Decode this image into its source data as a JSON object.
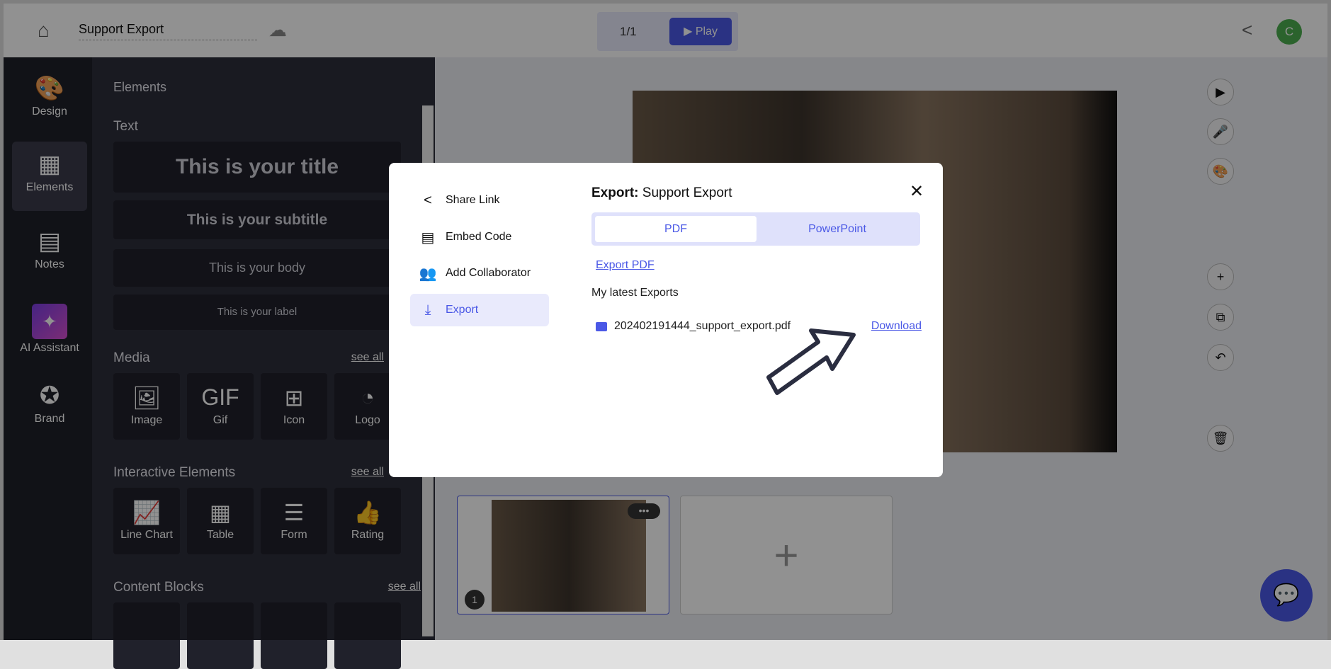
{
  "topbar": {
    "title": "Support Export",
    "page_indicator": "1/1",
    "play_label": "Play",
    "avatar_initial": "C",
    "avatar_color": "#4caf50"
  },
  "rail": [
    {
      "label": "Design",
      "icon": "palette-icon"
    },
    {
      "label": "Elements",
      "icon": "grid-icon"
    },
    {
      "label": "Notes",
      "icon": "notes-icon"
    },
    {
      "label": "AI Assistant",
      "icon": "sparkle-icon"
    },
    {
      "label": "Brand",
      "icon": "badge-check-icon"
    }
  ],
  "panel": {
    "heading": "Elements",
    "text_section": "Text",
    "text_cards": [
      "This is your title",
      "This is your subtitle",
      "This is your body",
      "This is your label"
    ],
    "media_section": "Media",
    "media_see_all": "see all",
    "media": [
      "Image",
      "Gif",
      "Icon",
      "Logo"
    ],
    "interactive_section": "Interactive Elements",
    "interactive_see_all": "see all",
    "interactive": [
      "Line Chart",
      "Table",
      "Form",
      "Rating"
    ],
    "content_section": "Content Blocks",
    "content_see_all": "see all"
  },
  "thumbnails": [
    {
      "number": "1"
    }
  ],
  "modal": {
    "nav": [
      "Share Link",
      "Embed Code",
      "Add Collaborator",
      "Export"
    ],
    "active_nav": "Export",
    "title_prefix": "Export:",
    "title": "Support Export",
    "tabs": [
      "PDF",
      "PowerPoint"
    ],
    "active_tab": "PDF",
    "export_link": "Export PDF",
    "latest_heading": "My latest Exports",
    "exports": [
      {
        "file": "202402191444_support_export.pdf",
        "action": "Download"
      }
    ]
  },
  "accent": "#4a58e6"
}
